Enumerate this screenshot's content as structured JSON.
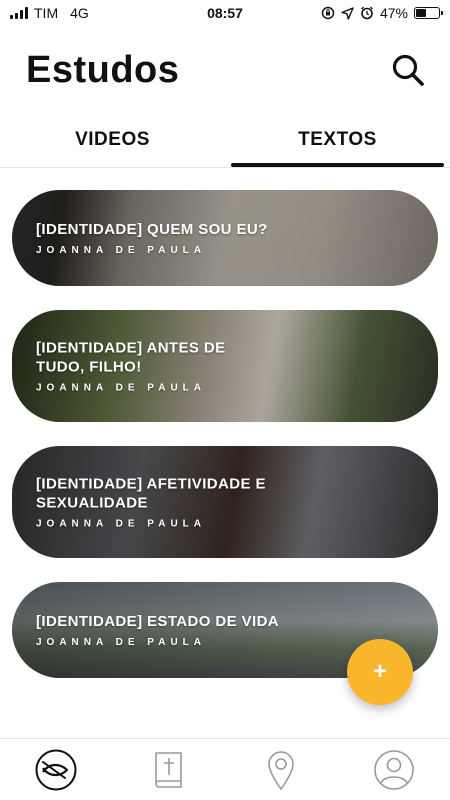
{
  "status_bar": {
    "carrier": "TIM",
    "network": "4G",
    "time": "08:57",
    "battery": "47%",
    "battery_level": 0.47
  },
  "header": {
    "title": "Estudos",
    "search_icon": "search-icon"
  },
  "tabs": [
    {
      "label": "VIDEOS",
      "active": false
    },
    {
      "label": "TEXTOS",
      "active": true
    }
  ],
  "studies": [
    {
      "title": "[IDENTIDADE] QUEM SOU EU?",
      "author": "JOANNA DE PAULA"
    },
    {
      "title": "[IDENTIDADE] ANTES DE TUDO, FILHO!",
      "author": "JOANNA DE PAULA"
    },
    {
      "title": "[IDENTIDADE] AFETIVIDADE E SEXUALIDADE",
      "author": "JOANNA DE PAULA"
    },
    {
      "title": "[IDENTIDADE] ESTADO DE VIDA",
      "author": "JOANNA DE PAULA"
    }
  ],
  "fab": {
    "label": "+",
    "color": "#f9b52c"
  },
  "bottom_nav": [
    {
      "icon": "fish-icon",
      "active": true
    },
    {
      "icon": "bible-icon",
      "active": false
    },
    {
      "icon": "location-pin-icon",
      "active": false
    },
    {
      "icon": "user-profile-icon",
      "active": false
    }
  ]
}
